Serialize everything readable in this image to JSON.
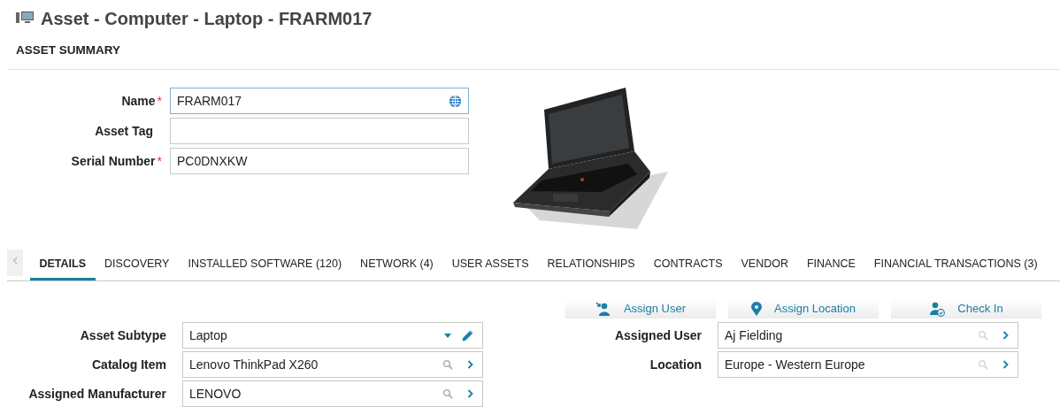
{
  "title": "Asset - Computer - Laptop - FRARM017",
  "summary": {
    "heading": "ASSET SUMMARY",
    "fields": [
      {
        "label": "Name",
        "required_mark": "*",
        "value": "FRARM017",
        "focused": true,
        "kind": "globe"
      },
      {
        "label": "Asset Tag",
        "focused": false,
        "kind": "plain"
      },
      {
        "label": "Serial Number",
        "required_mark": "*",
        "value": "PC0DNXKW",
        "focused": false,
        "kind": "plain"
      }
    ]
  },
  "tabs": [
    {
      "label": "DETAILS",
      "selected": true
    },
    {
      "label": "DISCOVERY",
      "selected": false
    },
    {
      "label": "INSTALLED SOFTWARE (120)",
      "selected": false
    },
    {
      "label": "NETWORK (4)",
      "selected": false
    },
    {
      "label": "USER ASSETS",
      "selected": false
    },
    {
      "label": "RELATIONSHIPS",
      "selected": false
    },
    {
      "label": "CONTRACTS",
      "selected": false
    },
    {
      "label": "VENDOR",
      "selected": false
    },
    {
      "label": "FINANCE",
      "selected": false
    },
    {
      "label": "FINANCIAL TRANSACTIONS (3)",
      "selected": false
    }
  ],
  "actions": [
    {
      "label": "Assign User",
      "kind": "assign-user"
    },
    {
      "label": "Assign Location",
      "kind": "location"
    },
    {
      "label": "Check In",
      "kind": "check-in"
    }
  ],
  "details_left": [
    {
      "label": "Asset Subtype",
      "value": "Laptop",
      "kind": "dropdown"
    },
    {
      "label": "Catalog Item",
      "value": "Lenovo ThinkPad X260",
      "kind": "lookup"
    },
    {
      "label": "Assigned Manufacturer",
      "value": "LENOVO",
      "kind": "lookup"
    }
  ],
  "details_right": [
    {
      "label": "Assigned User",
      "value": "Aj Fielding",
      "kind": "lookup-faint"
    },
    {
      "label": "Location",
      "value": "Europe - Western Europe",
      "kind": "lookup-faint"
    }
  ]
}
